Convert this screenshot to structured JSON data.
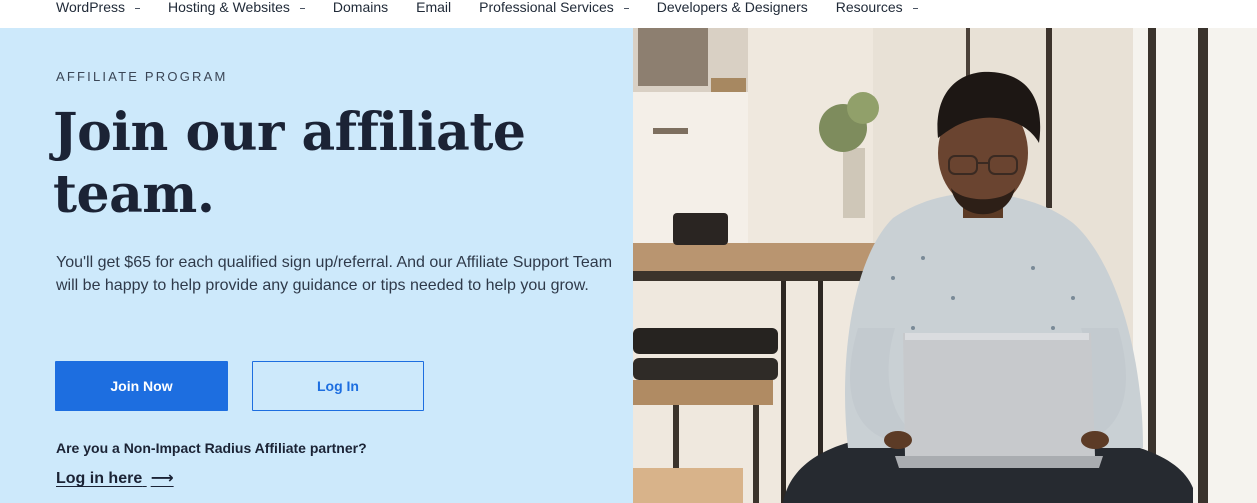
{
  "nav": {
    "items": [
      {
        "label": "WordPress",
        "has_menu": true
      },
      {
        "label": "Hosting & Websites",
        "has_menu": true
      },
      {
        "label": "Domains",
        "has_menu": false
      },
      {
        "label": "Email",
        "has_menu": false
      },
      {
        "label": "Professional Services",
        "has_menu": true
      },
      {
        "label": "Developers & Designers",
        "has_menu": false
      },
      {
        "label": "Resources",
        "has_menu": true
      }
    ]
  },
  "hero": {
    "eyebrow": "AFFILIATE PROGRAM",
    "headline": "Join our affiliate team.",
    "lead": "You'll get $65 for each qualified sign up/referral. And our Affiliate Support Team will be happy to help provide any guidance or tips needed to help you grow.",
    "join_button": "Join Now",
    "login_button": "Log In",
    "partner_question": "Are you a Non-Impact Radius Affiliate partner?",
    "partner_link": "Log in here",
    "partner_link_arrow": "⟶",
    "image": {
      "subject": "photo-man-with-laptop"
    }
  },
  "colors": {
    "hero_bg": "#cde9fb",
    "accent": "#1d6ee0",
    "heading": "#1b2335"
  }
}
